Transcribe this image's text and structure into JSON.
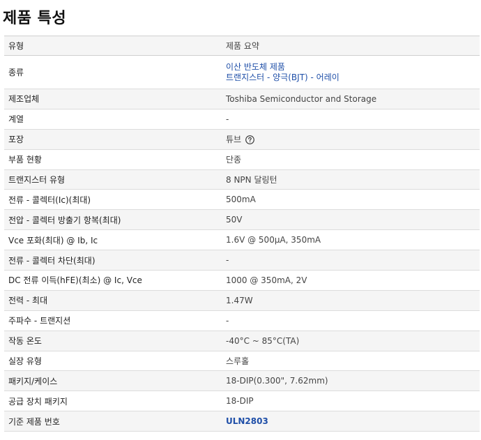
{
  "page_title": "제품 특성",
  "table": {
    "header": {
      "col1": "유형",
      "col2": "제품 요약"
    },
    "rows": [
      {
        "label": "종류",
        "value_lines": [
          "이산 반도체 제품",
          "트랜지스터 - 양극(BJT) - 어레이"
        ]
      },
      {
        "label": "제조업체",
        "value": "Toshiba Semiconductor and Storage"
      },
      {
        "label": "계열",
        "value": "-"
      },
      {
        "label": "포장",
        "value": "튜브",
        "icon": "question-circle-icon"
      },
      {
        "label": "부품 현황",
        "value": "단종"
      },
      {
        "label": "트랜지스터 유형",
        "value": "8 NPN 달링턴"
      },
      {
        "label": "전류 - 콜렉터(Ic)(최대)",
        "value": "500mA"
      },
      {
        "label": "전압 - 콜렉터 방출기 항복(최대)",
        "value": "50V"
      },
      {
        "label": "Vce 포화(최대) @ Ib, Ic",
        "value": "1.6V @ 500µA, 350mA"
      },
      {
        "label": "전류 - 콜렉터 차단(최대)",
        "value": "-"
      },
      {
        "label": "DC 전류 이득(hFE)(최소) @ Ic, Vce",
        "value": "1000 @ 350mA, 2V"
      },
      {
        "label": "전력 - 최대",
        "value": "1.47W"
      },
      {
        "label": "주파수 - 트랜지션",
        "value": "-"
      },
      {
        "label": "작동 온도",
        "value": "-40°C ~ 85°C(TA)"
      },
      {
        "label": "실장 유형",
        "value": "스루홀"
      },
      {
        "label": "패키지/케이스",
        "value": "18-DIP(0.300\", 7.62mm)"
      },
      {
        "label": "공급 장치 패키지",
        "value": "18-DIP"
      },
      {
        "label": "기준 제품 번호",
        "value": "ULN2803"
      }
    ]
  },
  "colors": {
    "link": "#1f4fa8",
    "row_alt": "#f5f5f5",
    "border": "#dcdcdc"
  }
}
